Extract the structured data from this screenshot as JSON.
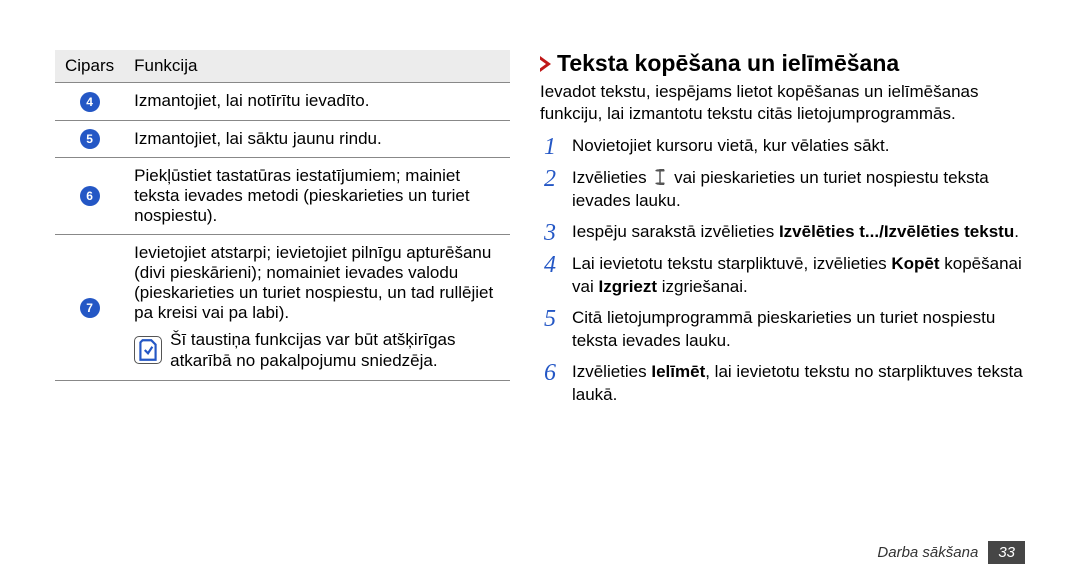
{
  "table": {
    "head": {
      "num": "Cipars",
      "func": "Funkcija"
    },
    "rows": [
      {
        "n": "4",
        "text": "Izmantojiet, lai notīrītu ievadīto."
      },
      {
        "n": "5",
        "text": "Izmantojiet, lai sāktu jaunu rindu."
      },
      {
        "n": "6",
        "text": "Piekļūstiet tastatūras iestatījumiem; mainiet teksta ievades metodi (pieskarieties un turiet nospiestu)."
      },
      {
        "n": "7",
        "text": "Ievietojiet atstarpi; ievietojiet pilnīgu apturēšanu (divi pieskārieni); nomainiet ievades valodu (pieskarieties un turiet nospiestu, un tad rullējiet pa kreisi vai pa labi).",
        "note": "Šī taustiņa funkcijas var būt atšķirīgas atkarībā no pakalpojumu sniedzēja."
      }
    ]
  },
  "right": {
    "heading": "Teksta kopēšana un ielīmēšana",
    "intro": "Ievadot tekstu, iespējams lietot kopēšanas un ielīmēšanas funkciju, lai izmantotu tekstu citās lietojumprogrammās.",
    "steps": {
      "s1": "Novietojiet kursoru vietā, kur vēlaties sākt.",
      "s2a": "Izvēlieties ",
      "s2b": " vai pieskarieties un turiet nospiestu teksta ievades lauku.",
      "s3a": "Iespēju sarakstā izvēlieties ",
      "s3b": "Izvēlēties t.../Izvēlēties tekstu",
      "s3c": ".",
      "s4a": "Lai ievietotu tekstu starpliktuvē, izvēlieties ",
      "s4b": "Kopēt",
      "s4c": " kopēšanai vai ",
      "s4d": "Izgriezt",
      "s4e": " izgriešanai.",
      "s5": "Citā lietojumprogrammā pieskarieties un turiet nospiestu teksta ievades lauku.",
      "s6a": "Izvēlieties ",
      "s6b": "Ielīmēt",
      "s6c": ", lai ievietotu tekstu no starpliktuves teksta laukā."
    }
  },
  "footer": {
    "label": "Darba sākšana",
    "page": "33"
  }
}
